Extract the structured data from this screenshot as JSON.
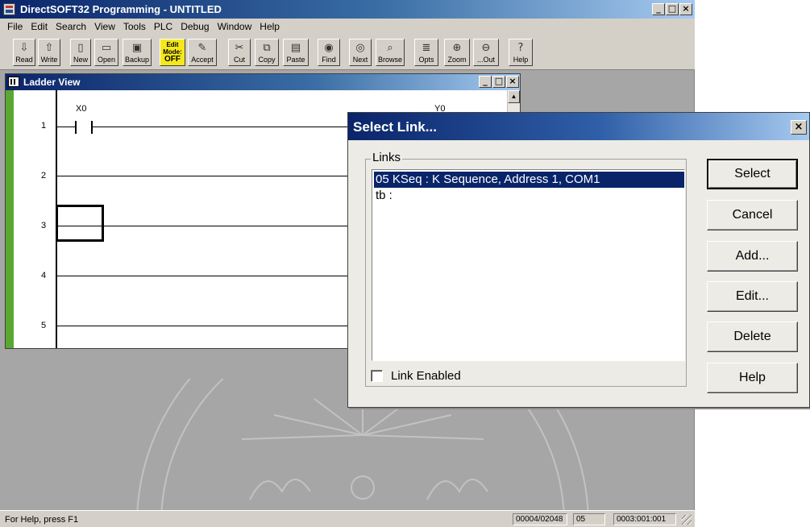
{
  "app": {
    "title": "DirectSOFT32 Programming - UNTITLED",
    "window_buttons": [
      "_",
      "□",
      "×"
    ]
  },
  "menu": [
    "File",
    "Edit",
    "Search",
    "View",
    "Tools",
    "PLC",
    "Debug",
    "Window",
    "Help"
  ],
  "toolbar": {
    "buttons": [
      {
        "label": "Read",
        "icon": "read-icon"
      },
      {
        "label": "Write",
        "icon": "write-icon"
      },
      {
        "label": "New",
        "icon": "new-document-icon"
      },
      {
        "label": "Open",
        "icon": "open-folder-icon"
      },
      {
        "label": "Backup",
        "icon": "backup-icon"
      },
      {
        "label": "Accept",
        "icon": "accept-icon"
      },
      {
        "label": "Cut",
        "icon": "scissors-icon"
      },
      {
        "label": "Copy",
        "icon": "copy-icon"
      },
      {
        "label": "Paste",
        "icon": "paste-icon"
      },
      {
        "label": "Find",
        "icon": "binoculars-icon"
      },
      {
        "label": "Next",
        "icon": "find-next-icon"
      },
      {
        "label": "Browse",
        "icon": "browse-icon"
      },
      {
        "label": "Opts",
        "icon": "options-icon"
      },
      {
        "label": "Zoom",
        "icon": "zoom-in-icon"
      },
      {
        "label": "...Out",
        "icon": "zoom-out-icon"
      },
      {
        "label": "Help",
        "icon": "help-icon"
      }
    ],
    "edit_mode": {
      "line1": "Edit",
      "line2": "Mode:",
      "state": "OFF"
    }
  },
  "ladder": {
    "title": "Ladder View",
    "rungs": [
      "1",
      "2",
      "3",
      "4",
      "5"
    ],
    "contact_label": "X0",
    "coil_label": "Y0"
  },
  "dialog": {
    "title": "Select Link...",
    "close": "×",
    "group_label": "Links",
    "links": [
      {
        "text": "05 KSeq : K Sequence, Address 1, COM1",
        "selected": true
      },
      {
        "text": "tb :",
        "selected": false
      }
    ],
    "link_enabled_label": "Link Enabled",
    "link_enabled": false,
    "buttons": [
      "Select",
      "Cancel",
      "Add...",
      "Edit...",
      "Delete",
      "Help"
    ]
  },
  "status": {
    "help_text": "For Help, press F1",
    "panels": [
      "00004/02048",
      "05",
      "0003:001:001"
    ]
  }
}
